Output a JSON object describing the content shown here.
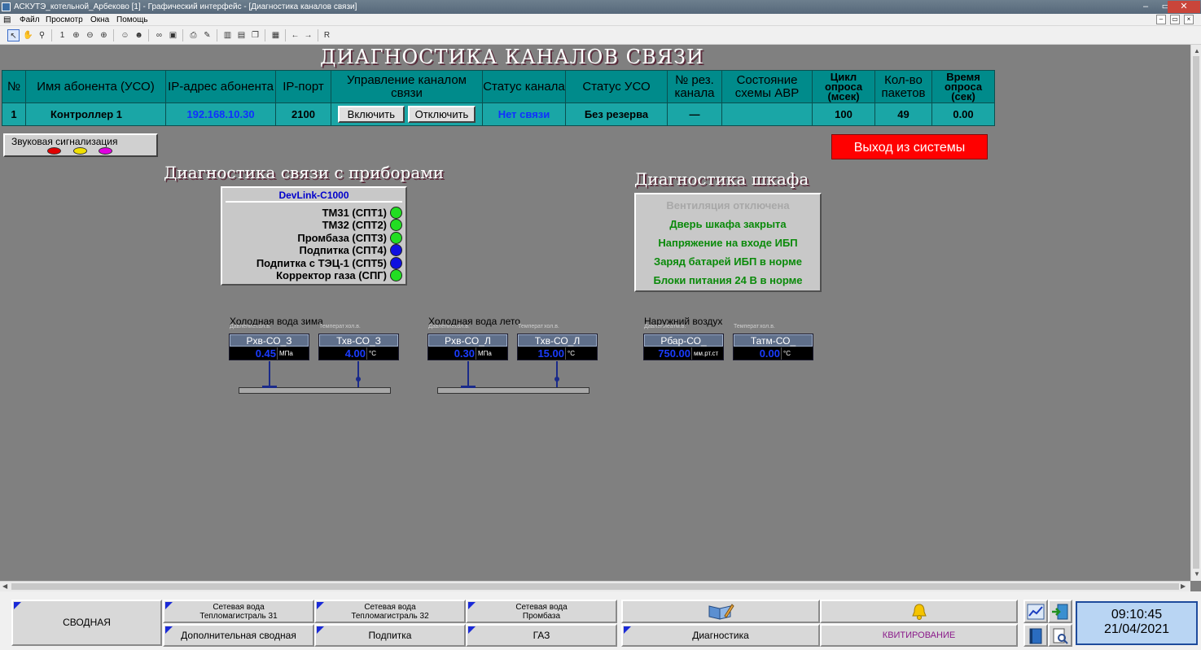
{
  "window": {
    "title": "АСКУТЭ_котельной_Арбеково [1] - Графический интерфейс - [Диагностика каналов связи]",
    "menu": [
      "Файл",
      "Просмотр",
      "Окна",
      "Помощь"
    ],
    "toolbar_letter": "R"
  },
  "page": {
    "title": "ДИАГНОСТИКА КАНАЛОВ СВЯЗИ"
  },
  "table": {
    "headers": [
      "№",
      "Имя абонента (УСО)",
      "IP-адрес абонента",
      "IP-порт",
      "Управление каналом связи",
      "Статус канала",
      "Статус УСО",
      "№ рез. канала",
      "Состояние схемы АВР",
      "Цикл опроса (мсек)",
      "Кол-во пакетов",
      "Время опроса (сек)"
    ],
    "row": {
      "num": "1",
      "name": "Контроллер 1",
      "ip": "192.168.10.30",
      "port": "2100",
      "on_label": "Включить",
      "off_label": "Отключить",
      "channel_status": "Нет связи",
      "uso_status": "Без резерва",
      "reserve_channel": "—",
      "avr_state": "",
      "cycle": "100",
      "packets": "49",
      "poll_time": "0.00"
    }
  },
  "sound": {
    "label": "Звуковая сигнализация",
    "colors": [
      "#e00000",
      "#f0e000",
      "#e000e0"
    ]
  },
  "exit_label": "Выход из системы",
  "devices": {
    "section_title": "Диагностика связи с приборами",
    "header": "DevLink-C1000",
    "items": [
      {
        "label": "ТМ31 (СПТ1)",
        "color": "#22dd22"
      },
      {
        "label": "ТМ32 (СПТ2)",
        "color": "#22dd22"
      },
      {
        "label": "Промбаза (СПТ3)",
        "color": "#22dd22"
      },
      {
        "label": "Подпитка (СПТ4)",
        "color": "#1010e0"
      },
      {
        "label": "Подпитка с ТЭЦ-1 (СПТ5)",
        "color": "#1010e0"
      },
      {
        "label": "Корректор газа (СПГ)",
        "color": "#22dd22"
      }
    ]
  },
  "cabinet": {
    "section_title": "Диагностика шкафа",
    "items": [
      {
        "label": "Вентиляция отключена",
        "color": "#a8a8a8"
      },
      {
        "label": "Дверь шкафа закрыта",
        "color": "#0a8a0a"
      },
      {
        "label": "Напряжение на входе ИБП",
        "color": "#0a8a0a"
      },
      {
        "label": "Заряд батарей ИБП в норме",
        "color": "#0a8a0a"
      },
      {
        "label": "Блоки питания 24 В в норме",
        "color": "#0a8a0a"
      }
    ]
  },
  "sensor_groups": [
    {
      "label": "Холодная вода зима",
      "sublabels": [
        "Давление",
        "хол.в.",
        "Температ",
        "хол.в."
      ],
      "sensors": [
        {
          "name": "Рхв-СО_З",
          "value": "0.45",
          "unit": "МПа"
        },
        {
          "name": "Тхв-СО_З",
          "value": "4.00",
          "unit": "°С"
        }
      ]
    },
    {
      "label": "Холодная вода лето",
      "sublabels": [
        "Давление",
        "хол.в.",
        "Температ",
        "хол.в."
      ],
      "sensors": [
        {
          "name": "Рхв-СО_Л",
          "value": "0.30",
          "unit": "МПа"
        },
        {
          "name": "Тхв-СО_Л",
          "value": "15.00",
          "unit": "°С"
        }
      ]
    },
    {
      "label": "Наружний воздух",
      "sublabels": [
        "Давление",
        "атм.в.",
        "Температ",
        "хол.в."
      ],
      "sensors": [
        {
          "name": "Рбар-СО_",
          "value": "750.00",
          "unit": "мм.рт.ст"
        },
        {
          "name": "Татм-СО_",
          "value": "0.00",
          "unit": "°С"
        }
      ]
    }
  ],
  "nav": {
    "svodnaya": "СВОДНАЯ",
    "tm31_l1": "Сетевая вода",
    "tm31_l2": "Тепломагистраль 31",
    "tm32_l1": "Сетевая вода",
    "tm32_l2": "Тепломагистраль 32",
    "prom_l1": "Сетевая вода",
    "prom_l2": "Промбаза",
    "dop": "Дополнительная сводная",
    "podpitka": "Подпитка",
    "gaz": "ГАЗ",
    "diag": "Диагностика",
    "kvit": "КВИТИРОВАНИЕ"
  },
  "clock": {
    "time": "09:10:45",
    "date": "21/04/2021"
  }
}
